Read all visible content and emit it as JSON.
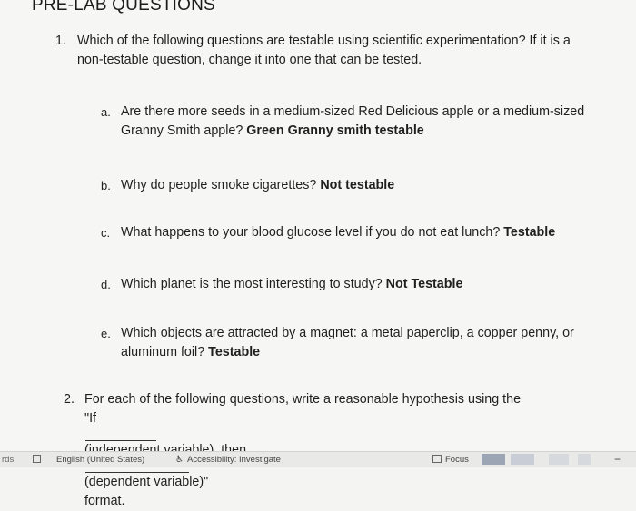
{
  "document": {
    "heading": "PRE-LAB QUESTIONS",
    "q1": {
      "number": "1.",
      "line1": "Which of the following questions are testable using scientific experimentation? If it is a",
      "line2": "non-testable question, change it into one that can be tested.",
      "items": [
        {
          "letter": "a.",
          "line1": "Are there more seeds in a medium-sized Red Delicious apple or a medium-sized",
          "line2": "Granny Smith apple?",
          "answer": "Green Granny smith testable"
        },
        {
          "letter": "b.",
          "line1": "Why do people smoke cigarettes?",
          "answer": "Not testable"
        },
        {
          "letter": "c.",
          "line1": "What happens to your blood glucose level if you do not eat lunch?",
          "answer": "Testable"
        },
        {
          "letter": "d.",
          "line1": "Which planet is the most interesting to study?",
          "answer": "Not Testable"
        },
        {
          "letter": "e.",
          "line1": "Which objects are attracted by a magnet: a metal paperclip, a copper penny, or",
          "line2": "aluminum foil?",
          "answer": "Testable"
        }
      ]
    },
    "q2": {
      "number": "2.",
      "line1": "For each of the following questions, write a reasonable hypothesis using the",
      "line2_a": "\"If",
      "line2_b": "(independent variable), then",
      "line2_c": "(dependent variable)\"",
      "line3": "format."
    }
  },
  "statusbar": {
    "words_label": "rds",
    "language": "English (United States)",
    "accessibility": "Accessibility: Investigate",
    "focus": "Focus"
  }
}
